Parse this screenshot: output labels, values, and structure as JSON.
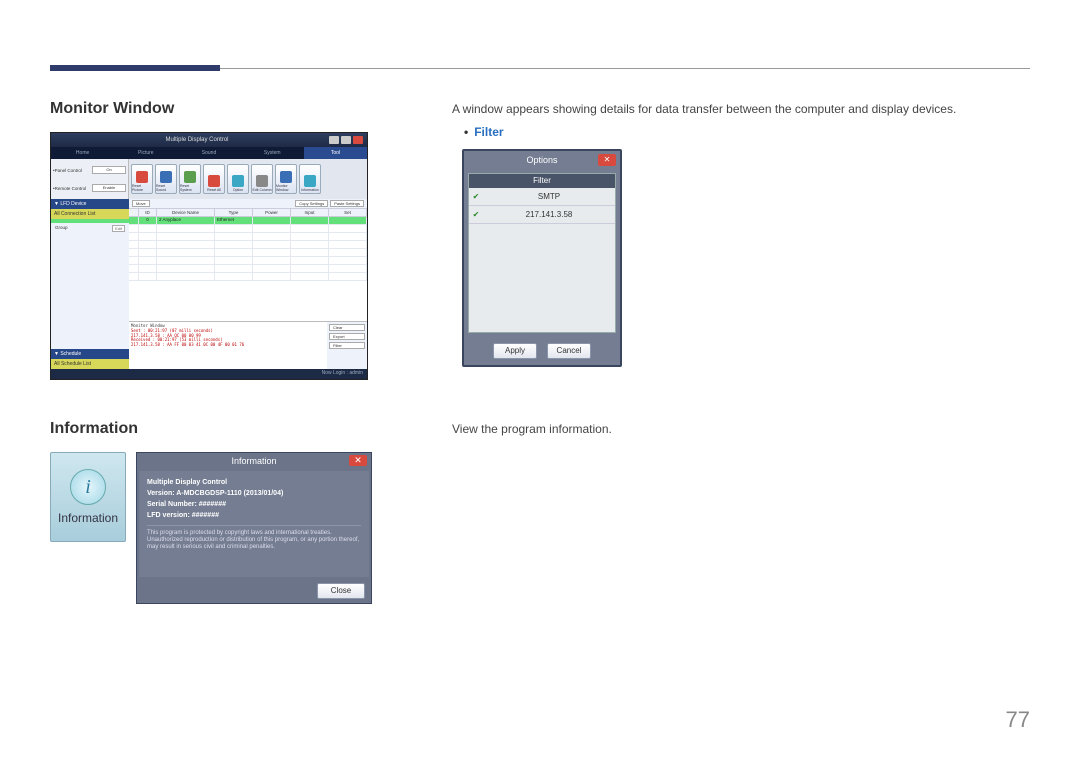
{
  "page_number": "77",
  "section1": {
    "heading": "Monitor Window",
    "desc": "A window appears showing details for data transfer between the computer and display devices.",
    "bullet": "Filter"
  },
  "section2": {
    "heading": "Information",
    "desc": "View the program information."
  },
  "app": {
    "title": "Multiple Display Control",
    "tabs": [
      "Home",
      "Picture",
      "Sound",
      "System",
      "Tool"
    ],
    "active_tab": 4,
    "panel_control_label": "•Panel Control",
    "panel_control_value": "On",
    "remote_control_label": "•Remote Control",
    "remote_control_value": "Enable",
    "tool_icons": [
      {
        "label": "Reset Picture",
        "cls": "g-red"
      },
      {
        "label": "Reset Sound",
        "cls": "g-blue"
      },
      {
        "label": "Reset System",
        "cls": "g-green"
      },
      {
        "label": "Reset All",
        "cls": "g-red"
      },
      {
        "label": "Option",
        "cls": "g-cyan"
      },
      {
        "label": "Edit Column",
        "cls": "g-gray"
      },
      {
        "label": "Monitor Window",
        "cls": "g-blue"
      },
      {
        "label": "Information",
        "cls": "g-cyan"
      }
    ],
    "side_lfd": "▼ LFD Device",
    "side_all": "All Connection List",
    "side_group": "Group",
    "side_edit": "Edit",
    "side_schedule": "▼ Schedule",
    "side_sched_all": "All Schedule List",
    "main_buttons": [
      "Move",
      "Copy Settings",
      "Paste Settings"
    ],
    "grid_headers": [
      "",
      "ID",
      "Device Name",
      "Type",
      "Power",
      "Input",
      "Set"
    ],
    "grid_row": {
      "id": "0",
      "name": "2 Anyplace",
      "type": "Ethernet",
      "power": "",
      "input": "",
      "set": ""
    },
    "monitor_label": "Monitor Window",
    "log": [
      "Sent : 00:21:97 (07 milli seconds)",
      "217.141.3.58 : AA OC 00 00 99",
      "",
      "Received : 00:21:97 (53 milli seconds)",
      "217.141.3.58 : AA FF 00 03 41 0C 00 4F 00 01 76"
    ],
    "mon_buttons": [
      "Clear",
      "Export",
      "Filter"
    ],
    "status": "Now Login : admin"
  },
  "options": {
    "title": "Options",
    "sub": "Filter",
    "rows": [
      "SMTP",
      "217.141.3.58"
    ],
    "apply": "Apply",
    "cancel": "Cancel"
  },
  "info_tile": {
    "label": "Information"
  },
  "info_dialog": {
    "title": "Information",
    "l1": "Multiple Display Control",
    "l2": "Version: A-MDCBGDSP-1110 (2013/01/04)",
    "l3": "Serial Number: #######",
    "l4": "LFD version: #######",
    "legal": "This program is protected by copyright laws and international treaties. Unauthorized reproduction or distribution of this program, or any portion thereof, may result in serious civil and criminal penalties.",
    "close": "Close"
  }
}
